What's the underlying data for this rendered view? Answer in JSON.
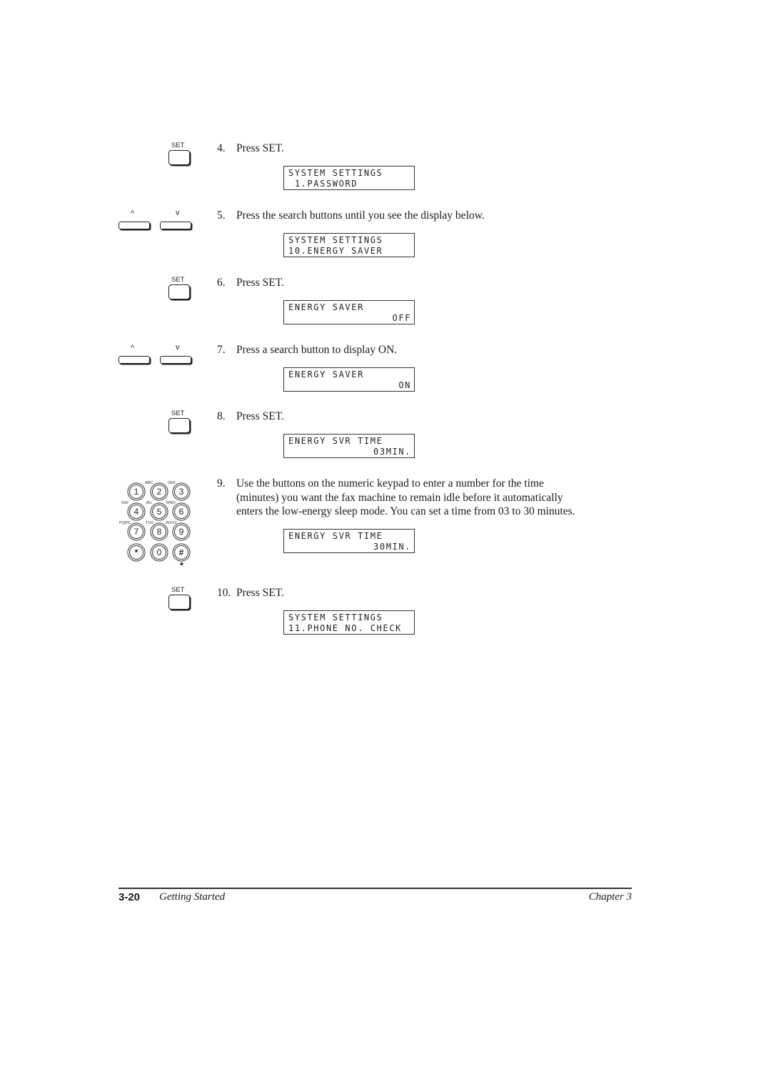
{
  "buttons": {
    "set_label": "SET",
    "search_up_label": "^",
    "search_down_label": "v"
  },
  "keypad": {
    "keys": [
      {
        "digit": "1",
        "letters": ""
      },
      {
        "digit": "2",
        "letters": "ABC"
      },
      {
        "digit": "3",
        "letters": "DEF"
      },
      {
        "digit": "4",
        "letters": "GHI"
      },
      {
        "digit": "5",
        "letters": "JKL"
      },
      {
        "digit": "6",
        "letters": "MNO"
      },
      {
        "digit": "7",
        "letters": "PQRS"
      },
      {
        "digit": "8",
        "letters": "TUV"
      },
      {
        "digit": "9",
        "letters": "WXYZ"
      },
      {
        "digit": "*",
        "letters": ""
      },
      {
        "digit": "0",
        "letters": ""
      },
      {
        "digit": "#",
        "letters": ""
      }
    ]
  },
  "steps": [
    {
      "number": "4.",
      "text": "Press SET.",
      "display": {
        "line1": "SYSTEM SETTINGS",
        "line2": " 1.PASSWORD"
      }
    },
    {
      "number": "5.",
      "text": "Press the search buttons until you see the display below.",
      "display": {
        "line1": "SYSTEM SETTINGS",
        "line2": "10.ENERGY SAVER"
      }
    },
    {
      "number": "6.",
      "text": "Press SET.",
      "display": {
        "line1": "ENERGY SAVER",
        "line2": "OFF"
      }
    },
    {
      "number": "7.",
      "text": "Press a search button to display ON.",
      "display": {
        "line1": "ENERGY SAVER",
        "line2": "ON"
      }
    },
    {
      "number": "8.",
      "text": "Press SET.",
      "display": {
        "line1": "ENERGY SVR TIME",
        "line2": "03MIN."
      }
    },
    {
      "number": "9.",
      "text_lines": [
        "Use the buttons on the numeric keypad to enter a number for the time",
        "(minutes) you want the fax machine to remain idle before it automatically",
        "enters the low-energy sleep mode. You can set a time from 03 to 30 minutes."
      ],
      "display": {
        "line1": "ENERGY SVR TIME",
        "line2": "30MIN."
      }
    },
    {
      "number": "10.",
      "text": "Press SET.",
      "display": {
        "line1": "SYSTEM SETTINGS",
        "line2": "11.PHONE NO. CHECK"
      }
    }
  ],
  "footer": {
    "page_number": "3-20",
    "section_title": "Getting Started",
    "chapter": "Chapter 3"
  }
}
